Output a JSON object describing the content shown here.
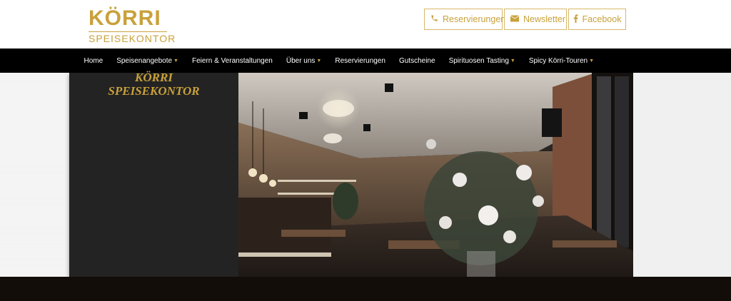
{
  "brand": {
    "logo_main": "KÖRRI",
    "logo_sub": "SPEISEKONTOR",
    "accent_color": "#c9a13b"
  },
  "top_buttons": [
    {
      "label": "Reservierungen",
      "icon": "phone-icon"
    },
    {
      "label": "Newsletter",
      "icon": "envelope-icon"
    },
    {
      "label": "Facebook",
      "icon": "facebook-icon"
    }
  ],
  "nav": {
    "items": [
      {
        "label": "Home",
        "dropdown": false
      },
      {
        "label": "Speisenangebote",
        "dropdown": true
      },
      {
        "label": "Feiern & Veranstaltungen",
        "dropdown": false
      },
      {
        "label": "Über uns",
        "dropdown": true
      },
      {
        "label": "Reservierungen",
        "dropdown": false
      },
      {
        "label": "Gutscheine",
        "dropdown": false
      },
      {
        "label": "Spirituosen Tasting",
        "dropdown": true
      },
      {
        "label": "Spicy Körri-Touren",
        "dropdown": true
      }
    ]
  },
  "panel": {
    "title_line1": "KÖRRI",
    "title_line2": "SPEISEKONTOR"
  }
}
